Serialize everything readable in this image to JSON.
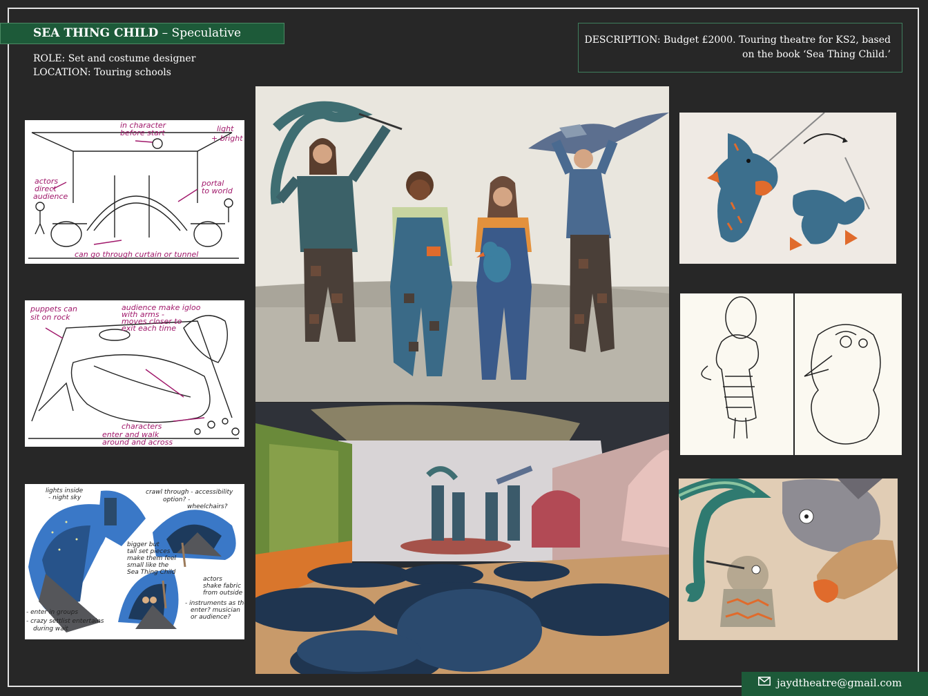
{
  "header": {
    "title_bold": "SEA THING CHILD",
    "title_rest": " – Speculative",
    "role": "ROLE: Set and costume designer",
    "location": "LOCATION: Touring schools"
  },
  "description": {
    "line1": "DESCRIPTION: Budget £2000. Touring theatre for KS2, based",
    "line2": "on the book ‘Sea Thing Child.’"
  },
  "sketch1": {
    "notes": [
      "in character",
      "before start",
      "light",
      "+ bright",
      "actors",
      "direct",
      "audience",
      "portal",
      "to world",
      "can go through curtain or tunnel"
    ]
  },
  "sketch2": {
    "notes": [
      "puppets can",
      "sit on rock",
      "audience make igloo",
      "with arms -",
      "moves closer to",
      "exit each time",
      "characters",
      "enter and walk",
      "around and across"
    ]
  },
  "sketch3": {
    "notes": [
      "lights inside",
      "- night sky",
      "crawl through - accessibility",
      "option? -",
      "wheelchairs?",
      "bigger but",
      "tall set pieces",
      "make them feel",
      "small like the",
      "Sea Thing Child",
      "actors",
      "shake fabric",
      "from outside",
      "- enter in groups",
      "- crazy settlist entertains",
      "during wait",
      "- instruments as they",
      "enter? musician",
      "or audience?"
    ]
  },
  "icons": {
    "email": "envelope-icon"
  },
  "contact": {
    "email": "jaydtheatre@gmail.com"
  },
  "colors": {
    "accent_green": "#1d5a39",
    "background": "#272727",
    "note_magenta": "#a0176a"
  }
}
